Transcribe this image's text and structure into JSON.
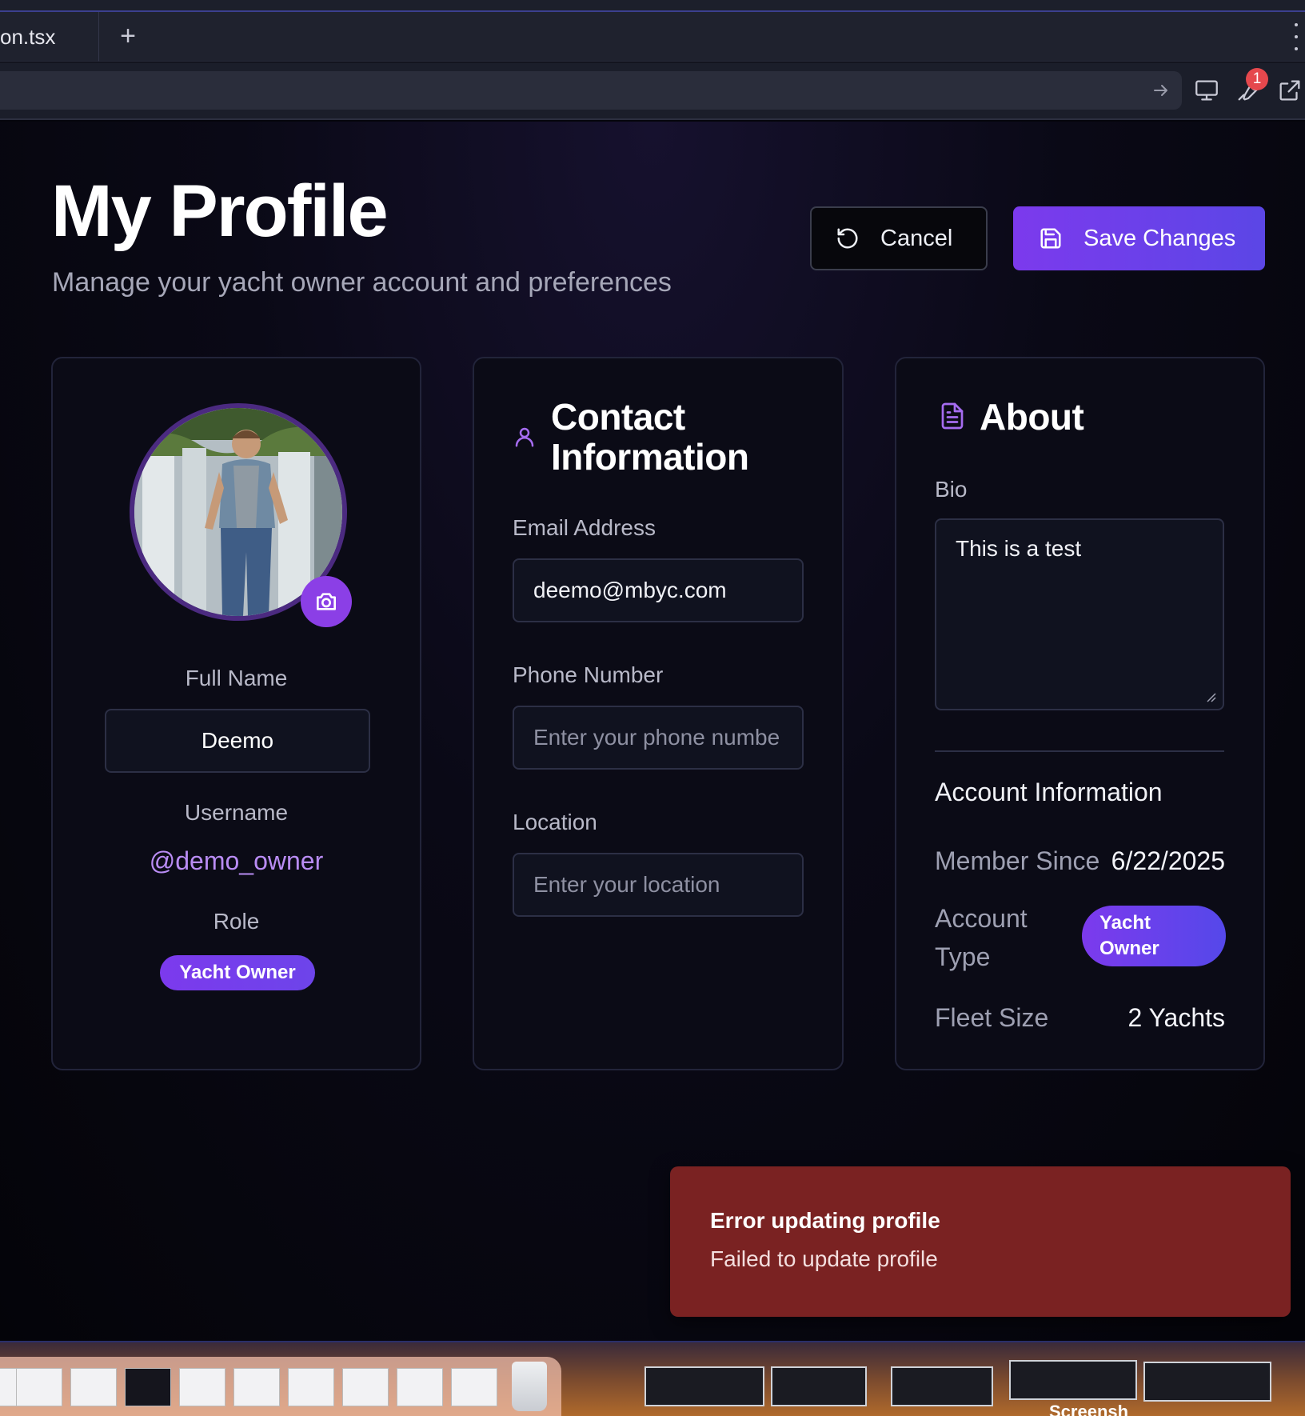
{
  "browser": {
    "tab_label": "on.tsx",
    "new_tab": "+",
    "notification_count": "1"
  },
  "header": {
    "title": "My Profile",
    "subtitle": "Manage your yacht owner account and preferences",
    "cancel_label": "Cancel",
    "save_label": "Save Changes"
  },
  "profile_card": {
    "full_name_label": "Full Name",
    "full_name_value": "Deemo",
    "username_label": "Username",
    "username_value": "@demo_owner",
    "role_label": "Role",
    "role_value": "Yacht Owner"
  },
  "contact_card": {
    "title_line1": "Contact",
    "title_line2": "Information",
    "email_label": "Email Address",
    "email_value": "deemo@mbyc.com",
    "phone_label": "Phone Number",
    "phone_placeholder": "Enter your phone numbe",
    "location_label": "Location",
    "location_placeholder": "Enter your location"
  },
  "about_card": {
    "title": "About",
    "bio_label": "Bio",
    "bio_value": "This is a test",
    "account_info_title": "Account Information",
    "member_since_label": "Member Since",
    "member_since_value": "6/22/2025",
    "account_type_label_1": "Account",
    "account_type_label_2": "Type",
    "account_type_value_1": "Yacht",
    "account_type_value_2": "Owner",
    "fleet_size_label": "Fleet Size",
    "fleet_size_value": "2 Yachts"
  },
  "toast": {
    "title": "Error updating profile",
    "description": "Failed to update profile"
  },
  "desktop": {
    "label": "Screensh"
  },
  "colors": {
    "accent": "#7c3aed",
    "error": "#7a2222",
    "background": "#05050c"
  }
}
